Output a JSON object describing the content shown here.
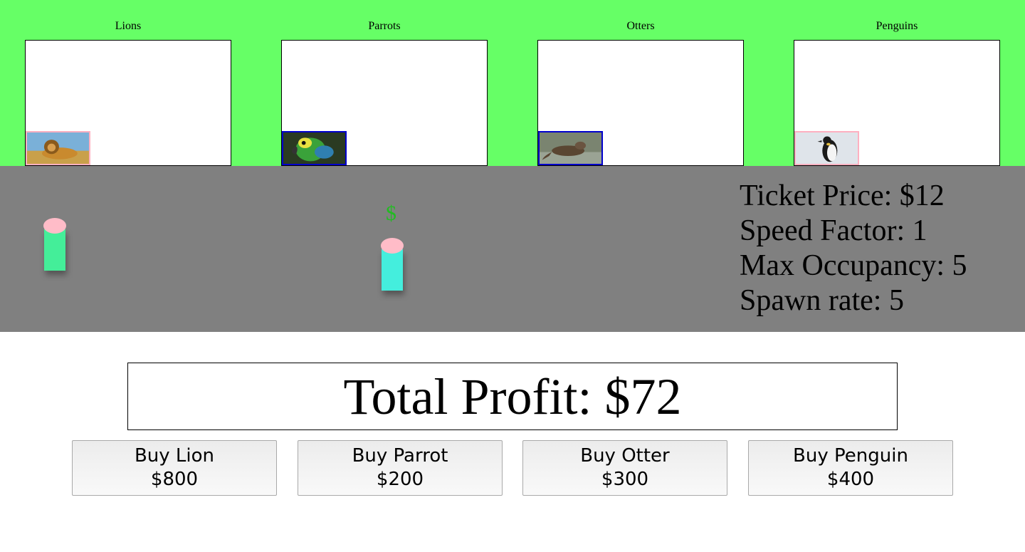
{
  "enclosures": [
    {
      "title": "Lions",
      "thumb_icon": "lion-photo",
      "border_color": "#ffb0c0"
    },
    {
      "title": "Parrots",
      "thumb_icon": "parrot-photo",
      "border_color": "#0000cc"
    },
    {
      "title": "Otters",
      "thumb_icon": "otter-photo",
      "border_color": "#0000cc"
    },
    {
      "title": "Penguins",
      "thumb_icon": "penguin-photo",
      "border_color": "#ffb0c0"
    }
  ],
  "colors": {
    "habitat_bg": "#66ff66",
    "path_bg": "#808080",
    "visitor_head": "#ffbcc8",
    "visitor_body_1": "#44ee99",
    "visitor_body_2": "#44eedd",
    "coin": "#22bb22"
  },
  "coin_symbol": "$",
  "stats": {
    "ticket_price": "Ticket Price: $12",
    "speed_factor": "Speed Factor: 1",
    "max_occupancy": "Max Occupancy: 5",
    "spawn_rate": "Spawn rate: 5"
  },
  "profit": {
    "label": "Total Profit: $72"
  },
  "buttons": [
    {
      "line1": "Buy Lion",
      "line2": "$800"
    },
    {
      "line1": "Buy Parrot",
      "line2": "$200"
    },
    {
      "line1": "Buy Otter",
      "line2": "$300"
    },
    {
      "line1": "Buy Penguin",
      "line2": "$400"
    }
  ]
}
